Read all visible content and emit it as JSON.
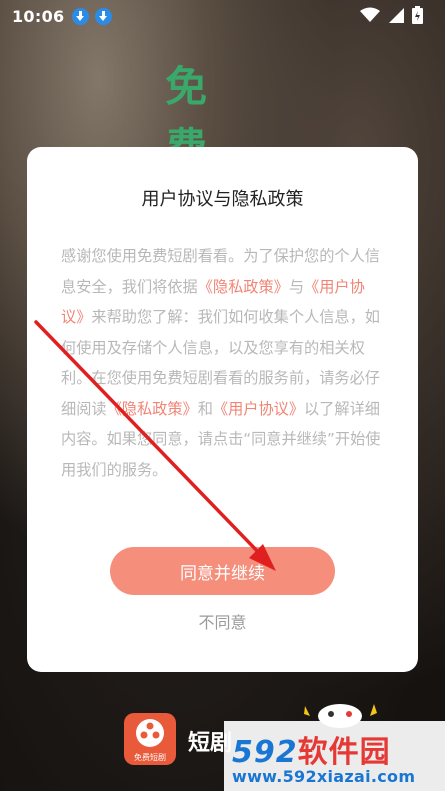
{
  "status_bar": {
    "time": "10:06",
    "icons": [
      "download-icon",
      "download-icon",
      "wifi-icon",
      "signal-icon",
      "battery-icon"
    ]
  },
  "background": {
    "title_char1": "免",
    "title_char2": "费"
  },
  "dialog": {
    "title": "用户协议与隐私政策",
    "body": [
      {
        "text": "感谢您使用免费短剧看看。为了保护您的个人信息安全，我们将依据",
        "link": false
      },
      {
        "text": "《隐私政策》",
        "link": true
      },
      {
        "text": "与",
        "link": false
      },
      {
        "text": "《用户协议》",
        "link": true
      },
      {
        "text": "来帮助您了解：我们如何收集个人信息，如何使用及存储个人信息，以及您享有的相关权利。在您使用免费短剧看看的服务前，请务必仔细阅读",
        "link": false
      },
      {
        "text": "《隐私政策》",
        "link": true
      },
      {
        "text": "和",
        "link": false
      },
      {
        "text": "《用户协议》",
        "link": true
      },
      {
        "text": "以了解详细内容。如果您同意，请点击“同意并继续”开始使用我们的服务。",
        "link": false
      }
    ],
    "agree_button": "同意并继续",
    "disagree_button": "不同意"
  },
  "bottom": {
    "app_logo_label": "免费短剧",
    "app_name": "短剧"
  },
  "watermark": {
    "number": "592",
    "text": "软件园",
    "url": "www.592xiazai.com"
  },
  "colors": {
    "accent": "#f58f7c",
    "link": "#f08575",
    "arrow": "#e02020",
    "bg_title": "#3aa86b"
  }
}
